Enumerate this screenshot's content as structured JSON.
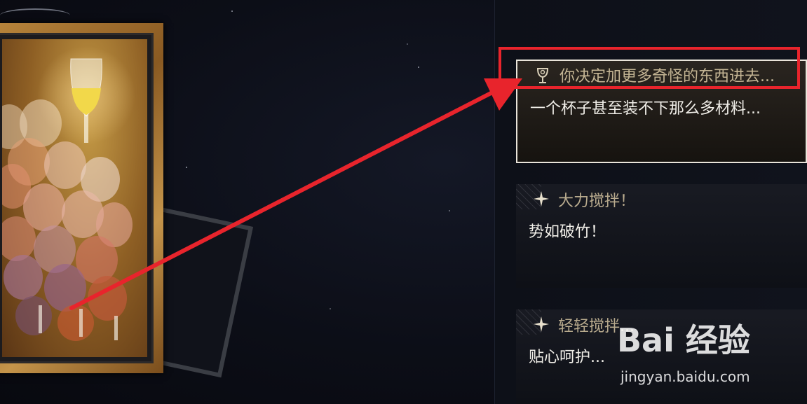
{
  "choices": [
    {
      "title": "你决定加更多奇怪的东西进去...",
      "body": "一个杯子甚至装不下那么多材料...",
      "icon": "goblet-icon",
      "selected": true
    },
    {
      "title": "大力搅拌！",
      "body": "势如破竹！",
      "icon": "sparkle-icon",
      "selected": false
    },
    {
      "title": "轻轻搅拌...",
      "body": "贴心呵护...",
      "icon": "sparkle-icon",
      "selected": false
    }
  ],
  "watermark": {
    "brand": "Bai 经验",
    "url": "jingyan.baidu.com"
  },
  "colors": {
    "highlight": "#e8242c",
    "title_gold": "#c4b594",
    "frame_gold": "#b9863c"
  }
}
